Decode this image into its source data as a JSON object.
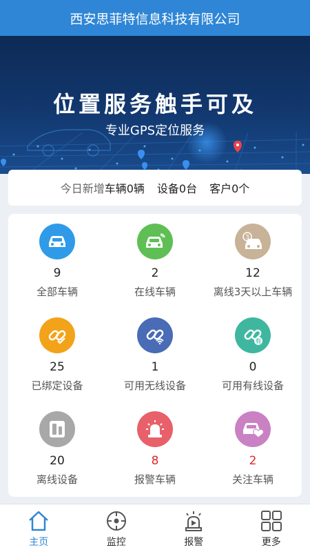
{
  "header": {
    "title": "西安思菲特信息科技有限公司"
  },
  "banner": {
    "title": "位置服务触手可及",
    "subtitle": "专业GPS定位服务"
  },
  "stats": {
    "prefix": "今日新增",
    "vehicles": "车辆0辆",
    "devices": "设备0台",
    "customers": "客户0个"
  },
  "grid": [
    {
      "count": "9",
      "label": "全部车辆",
      "icon": "car-icon",
      "color": "#2f9be8"
    },
    {
      "count": "2",
      "label": "在线车辆",
      "icon": "car-online-icon",
      "color": "#5fbf55"
    },
    {
      "count": "12",
      "label": "离线3天以上车辆",
      "icon": "car-offline-3-icon",
      "color": "#c8b398"
    },
    {
      "count": "25",
      "label": "已绑定设备",
      "icon": "link-check-icon",
      "color": "#f2a31a"
    },
    {
      "count": "1",
      "label": "可用无线设备",
      "icon": "link-wireless-icon",
      "color": "#4a6bb5"
    },
    {
      "count": "0",
      "label": "可用有线设备",
      "icon": "link-wired-icon",
      "color": "#3fb7a0"
    },
    {
      "count": "20",
      "label": "离线设备",
      "icon": "offline-device-icon",
      "color": "#a8a8a8"
    },
    {
      "count": "8",
      "label": "报警车辆",
      "icon": "alarm-light-icon",
      "color": "#e8606a",
      "highlight": true
    },
    {
      "count": "2",
      "label": "关注车辆",
      "icon": "car-heart-icon",
      "color": "#c981c4",
      "highlight": true
    }
  ],
  "tabs": [
    {
      "label": "主页",
      "icon": "home-icon",
      "active": true
    },
    {
      "label": "监控",
      "icon": "monitor-icon",
      "active": false
    },
    {
      "label": "报警",
      "icon": "alarm-icon",
      "active": false
    },
    {
      "label": "更多",
      "icon": "more-icon",
      "active": false
    }
  ],
  "colors": {
    "primary": "#2f86d6",
    "alert": "#e0252b"
  }
}
